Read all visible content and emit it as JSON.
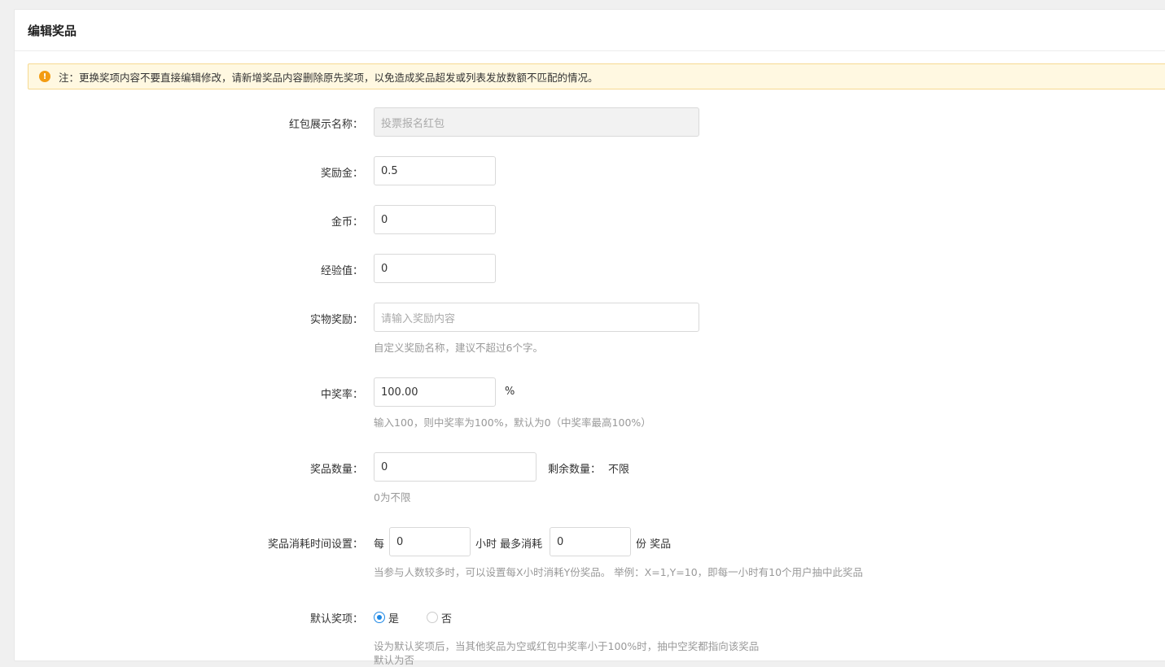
{
  "card": {
    "title": "编辑奖品"
  },
  "notice": {
    "icon": "warning-icon",
    "text": "注：更换奖项内容不要直接编辑修改，请新增奖品内容删除原先奖项，以免造成奖品超发或列表发放数额不匹配的情况。"
  },
  "form": {
    "display_name": {
      "label": "红包展示名称：",
      "value": "投票报名红包"
    },
    "reward_money": {
      "label": "奖励金：",
      "value": "0.5"
    },
    "gold": {
      "label": "金币：",
      "value": "0"
    },
    "exp": {
      "label": "经验值：",
      "value": "0"
    },
    "physical": {
      "label": "实物奖励：",
      "placeholder": "请输入奖励内容",
      "help": "自定义奖励名称，建议不超过6个字。"
    },
    "win_rate": {
      "label": "中奖率：",
      "value": "100.00",
      "unit": "%",
      "help": "输入100，则中奖率为100%，默认为0（中奖率最高100%）"
    },
    "quantity": {
      "label": "奖品数量：",
      "value": "0",
      "remaining_label": "剩余数量：",
      "remaining_value": "不限",
      "help": "0为不限"
    },
    "consume": {
      "label": "奖品消耗时间设置：",
      "prefix": "每",
      "hours_value": "0",
      "middle": "小时 最多消耗",
      "count_value": "0",
      "suffix": "份 奖品",
      "help": "当参与人数较多时，可以设置每X小时消耗Y份奖品。 举例：X=1,Y=10，即每一小时有10个用户抽中此奖品"
    },
    "default_item": {
      "label": "默认奖项：",
      "options": [
        "是",
        "否"
      ],
      "selected": "是",
      "help": "设为默认奖项后，当其他奖品为空或红包中奖率小于100%时，抽中空奖都指向该奖品",
      "help2": "默认为否"
    }
  }
}
